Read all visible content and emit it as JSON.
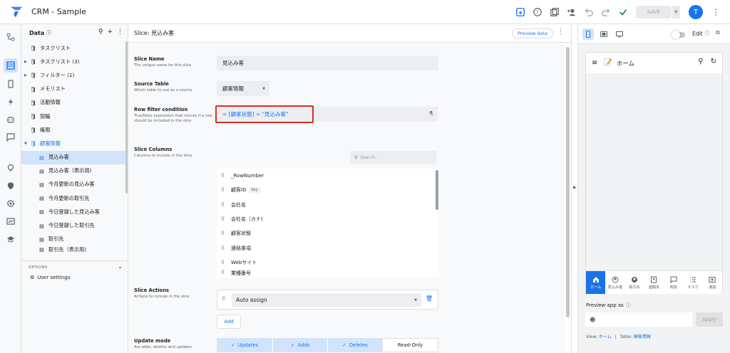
{
  "app": {
    "title": "CRM - Sample",
    "avatar_initial": "T",
    "save_label": "SAVE"
  },
  "data_panel": {
    "header": "Data",
    "items": [
      {
        "label": "タスクリスト",
        "count": ""
      },
      {
        "label": "タスクリスト (3)",
        "count": ""
      },
      {
        "label": "フィルター (1)",
        "count": ""
      },
      {
        "label": "メモリスト",
        "count": ""
      },
      {
        "label": "活動情報",
        "count": ""
      },
      {
        "label": "契輪",
        "count": ""
      },
      {
        "label": "権限",
        "count": ""
      },
      {
        "label": "顧客情報",
        "count": ""
      }
    ],
    "slices": [
      "見込み客",
      "見込み客（表示用)",
      "今月更新の見込み客",
      "今月更新の取引先",
      "今日登録した見込み客",
      "今日登録した取引先",
      "取引先",
      "取引先（表示用)"
    ],
    "options_label": "OPTIONS",
    "user_settings": "User settings"
  },
  "slice": {
    "header": "Slice: 見込み客",
    "preview_btn": "Preview data",
    "name_title": "Slice Name",
    "name_desc": "The unique name for this slice",
    "name_value": "見込み客",
    "source_title": "Source Table",
    "source_desc": "Which table to use as a source",
    "source_value": "顧客情報",
    "filter_title": "Row filter condition",
    "filter_desc": "True/false expression that checks if a row should be included in the slice",
    "filter_expr": "= [顧客状態] = \"見込み客\"",
    "columns_title": "Slice Columns",
    "columns_desc": "Columns to include in the slice",
    "search_placeholder": "Search..",
    "columns": [
      "_RowNumber",
      "顧客ID",
      "会社名",
      "会社名（カナ)",
      "顧客状態",
      "連絡事項",
      "Webサイト",
      "業種番号"
    ],
    "key_label": "Key",
    "actions_title": "Slice Actions",
    "actions_desc": "Actions to include in the slice",
    "action_value": "Auto assign",
    "add_label": "Add",
    "mode_title": "Update mode",
    "mode_desc": "Are adds, deletes and updates",
    "modes": [
      "Updates",
      "Adds",
      "Deletes",
      "Read-Only"
    ]
  },
  "preview": {
    "edit_label": "Edit",
    "screen_title": "ホーム",
    "nav": [
      "ホーム",
      "見込み客",
      "取引先",
      "連絡先",
      "商談",
      "タスク",
      "通話"
    ],
    "preview_as": "Preview app as",
    "apply": "Apply",
    "footer_view_label": "View:",
    "footer_view": "ホーム",
    "footer_sep": "|",
    "footer_table_label": "Table:",
    "footer_table": "顧客情報"
  },
  "colors": {
    "accent": "#1a73e8",
    "highlight": "#d93025",
    "selected_bg": "#d2e3fc"
  }
}
